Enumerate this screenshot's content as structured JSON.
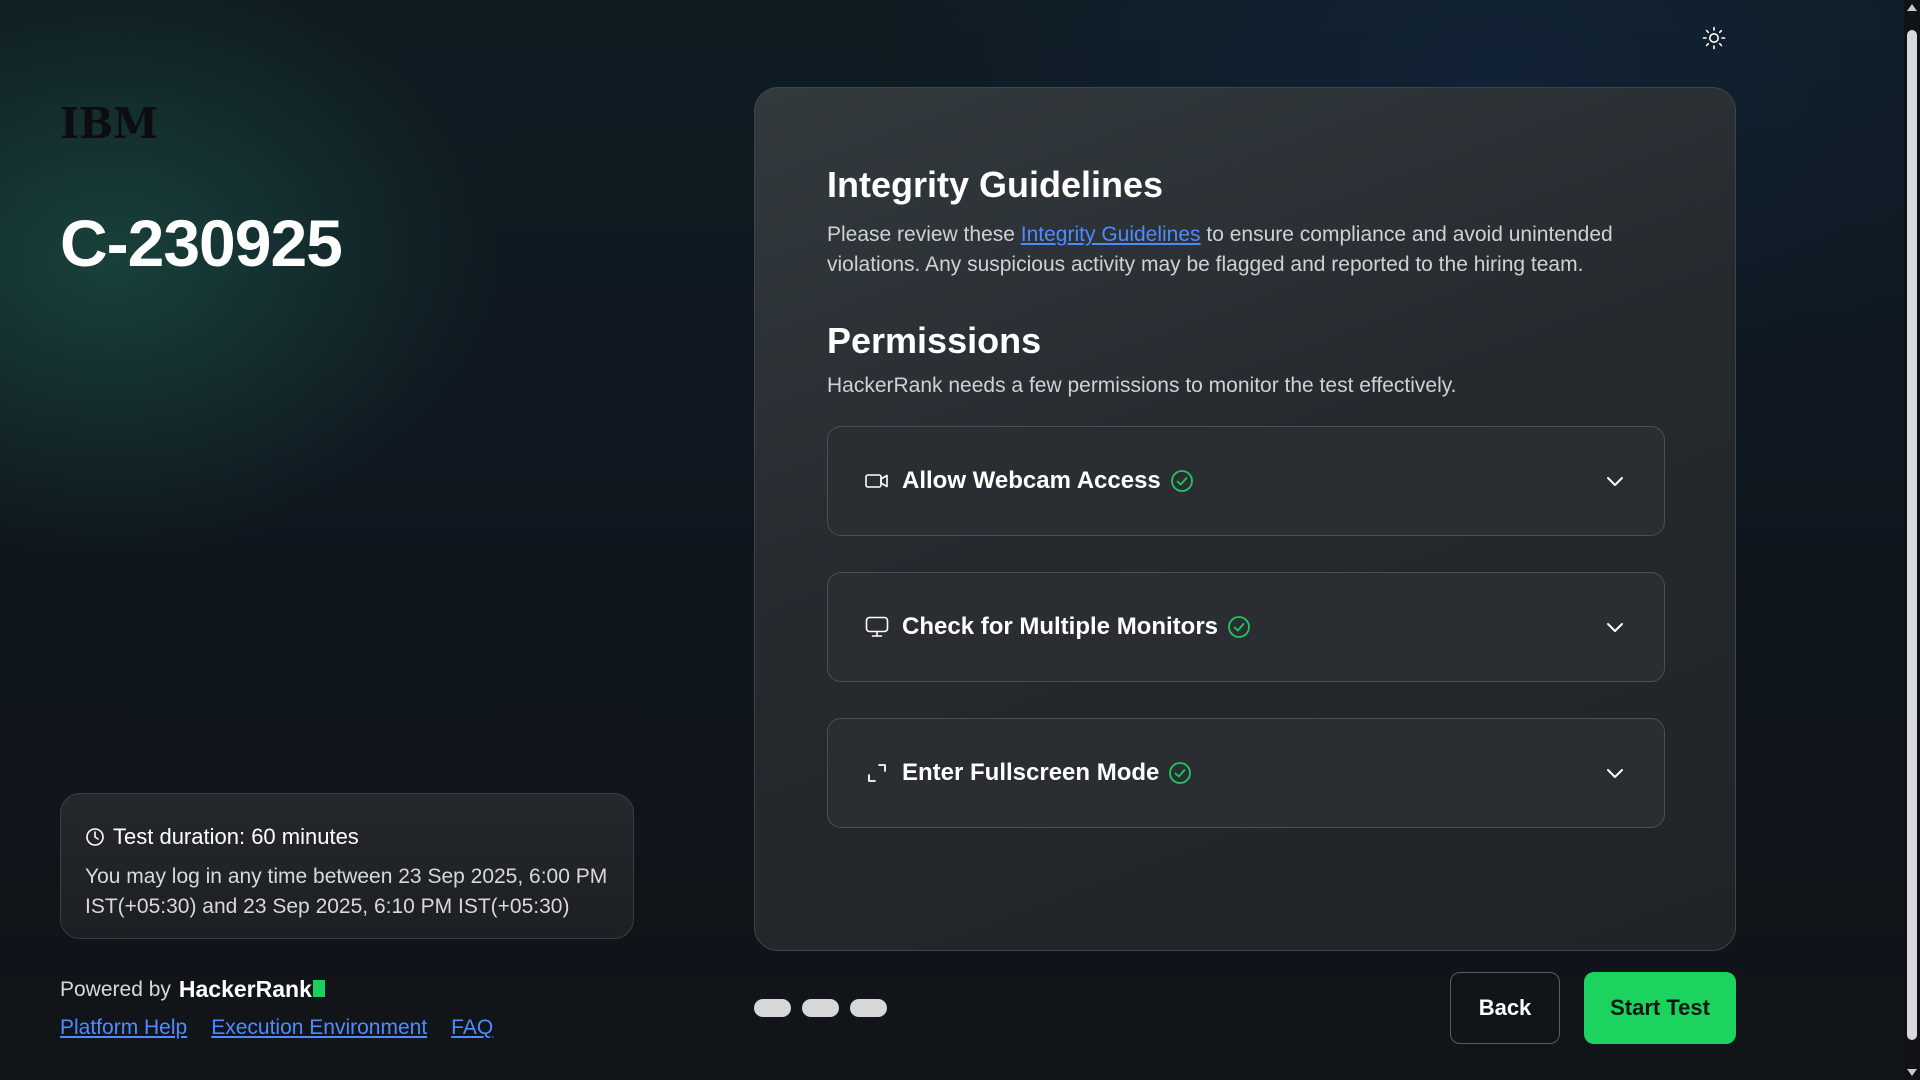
{
  "header": {
    "theme_toggle_icon": "sun-icon"
  },
  "left": {
    "logo_text": "IBM",
    "test_title": "C-230925",
    "info": {
      "clock_icon": "clock-icon",
      "duration": "Test duration: 60 minutes",
      "window": "You may log in any time between 23 Sep 2025, 6:00 PM IST(+05:30) and 23 Sep 2025, 6:10 PM IST(+05:30)"
    },
    "powered_by": "Powered by",
    "brand": "HackerRank",
    "brand_color": "#1ccf62",
    "links": [
      "Platform Help",
      "Execution Environment",
      "FAQ"
    ]
  },
  "panel": {
    "guidelines_title": "Integrity Guidelines",
    "guidelines_pre": "Please review these ",
    "guidelines_link": "Integrity Guidelines",
    "guidelines_post": " to ensure compliance and avoid unintended violations. Any suspicious activity may be flagged and reported to the hiring team.",
    "permissions_title": "Permissions",
    "permissions_text": "HackerRank needs a few permissions to monitor the test effectively.",
    "items": [
      {
        "label": "Allow Webcam Access",
        "icon": "webcam-icon",
        "status": "granted"
      },
      {
        "label": "Check for Multiple Monitors",
        "icon": "monitor-icon",
        "status": "granted"
      },
      {
        "label": "Enter Fullscreen Mode",
        "icon": "fullscreen-icon",
        "status": "granted"
      }
    ],
    "check_color": "#22c55e"
  },
  "footer": {
    "steps_total": 3,
    "back_label": "Back",
    "start_label": "Start Test",
    "accent": "#1dd35f"
  }
}
